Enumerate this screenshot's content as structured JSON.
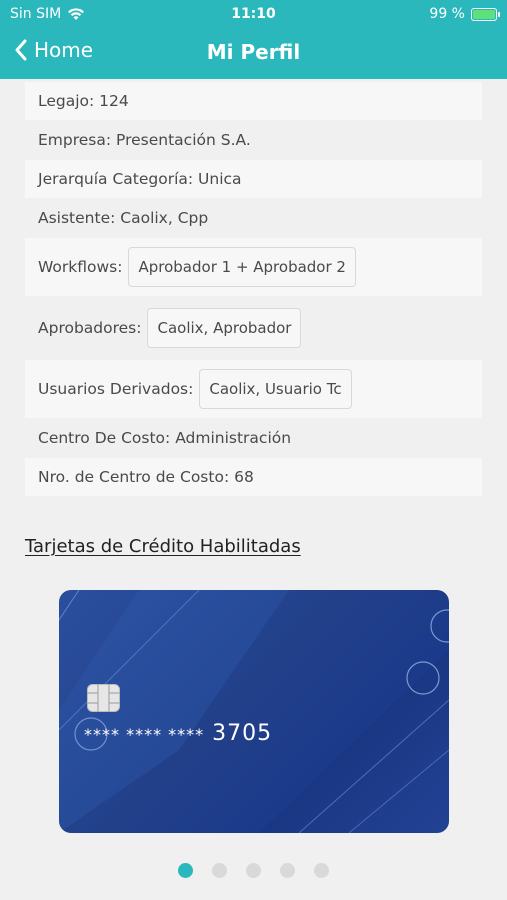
{
  "status_bar": {
    "carrier": "Sin SIM",
    "time": "11:10",
    "battery": "99 %",
    "battery_level": 0.99
  },
  "nav": {
    "back_label": "Home",
    "title": "Mi Perfil"
  },
  "profile": {
    "legajo": "Legajo: 124",
    "empresa": "Empresa: Presentación S.A.",
    "jerarquia": "Jerarquía Categoría: Unica",
    "asistente": "Asistente: Caolix, Cpp",
    "workflows_label": "Workflows:",
    "workflows_value": "Aprobador 1 + Aprobador 2",
    "aprobadores_label": "Aprobadores:",
    "aprobadores_value": "Caolix, Aprobador",
    "usuarios_label": "Usuarios Derivados:",
    "usuarios_value": "Caolix, Usuario Tc",
    "centro_costo": "Centro De Costo: Administración",
    "nro_centro": "Nro. de Centro de Costo: 68"
  },
  "cards_section": {
    "title": "Tarjetas de Crédito Habilitadas",
    "card": {
      "masked": "**** **** ****",
      "last4": "3705"
    },
    "pages": 5,
    "active_page": 1
  },
  "colors": {
    "accent": "#2bb8bd",
    "card_blue": "#22408a"
  }
}
